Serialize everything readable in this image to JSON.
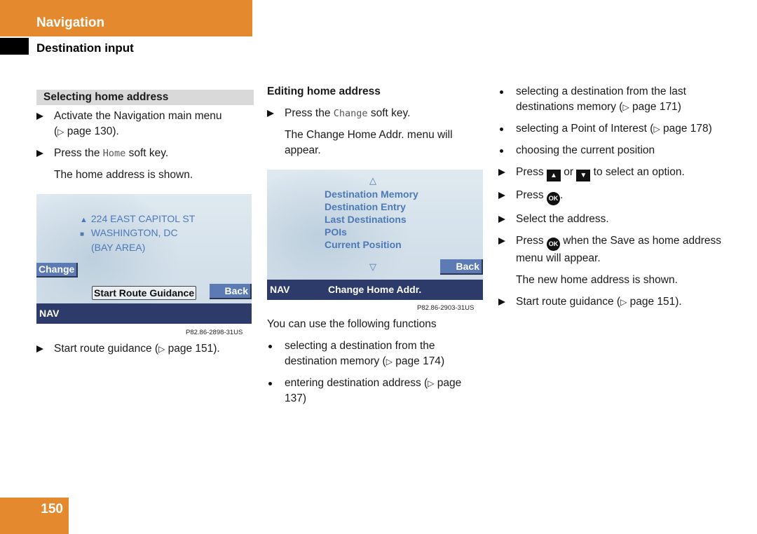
{
  "header": {
    "chapter": "Navigation",
    "section": "Destination input",
    "accent_color": "#e4892e"
  },
  "col1": {
    "subhead": "Selecting home address",
    "steps": [
      {
        "text": "Activate the Navigation main menu",
        "ref": "page 130",
        "suffix": "."
      },
      {
        "pre": "Press the ",
        "key": "Home",
        "post": " soft key."
      }
    ],
    "note": "The home address is shown.",
    "screen": {
      "address_line1": "224 EAST CAPITOL ST",
      "address_line2": "WASHINGTON, DC",
      "address_line3": "(BAY AREA)",
      "change_button": "Change",
      "start_route_button": "Start Route Guidance",
      "back_button": "Back",
      "status_bar": "NAV"
    },
    "caption": "P82.86-2898-31US",
    "final_step": {
      "text": "Start route guidance (",
      "ref": "page 151",
      "suffix": ")."
    }
  },
  "col2": {
    "subhead": "Editing home address",
    "step1": {
      "pre": "Press the ",
      "key": "Change",
      "post": " soft key."
    },
    "note": "The Change Home Addr. menu will appear.",
    "screen": {
      "menu_items": [
        "Destination Memory",
        "Destination Entry",
        "Last Destinations",
        "POIs",
        "Current Position"
      ],
      "back_button": "Back",
      "status_bar": "NAV",
      "status_title": "Change Home Addr."
    },
    "caption": "P82.86-2903-31US",
    "intro": "You can use the following functions",
    "bullets": [
      {
        "text": "selecting a destination from the destination memory (",
        "ref": "page 174",
        "suffix": ")"
      },
      {
        "text": "entering destination address (",
        "ref": "page 137",
        "suffix": ")"
      }
    ]
  },
  "col3": {
    "bullets": [
      {
        "text": "selecting a destination from the last destinations memory (",
        "ref": "page 171",
        "suffix": ")"
      },
      {
        "text": "selecting a Point of Interest (",
        "ref": "page 178",
        "suffix": ")"
      },
      {
        "text": "choosing the current position"
      }
    ],
    "steps": {
      "press": "Press",
      "or": "or",
      "select_option": "to select an option.",
      "ok_label": "OK",
      "press_ok_suffix": ".",
      "select_address": "Select the address.",
      "save_home": "when the Save as home address menu will appear.",
      "note": "The new home address is shown.",
      "final": {
        "text": "Start route guidance (",
        "ref": "page 151",
        "suffix": ")."
      }
    },
    "up_key_glyph": "▲",
    "down_key_glyph": "▼"
  },
  "ref_glyph": "▷",
  "page_number": "150"
}
